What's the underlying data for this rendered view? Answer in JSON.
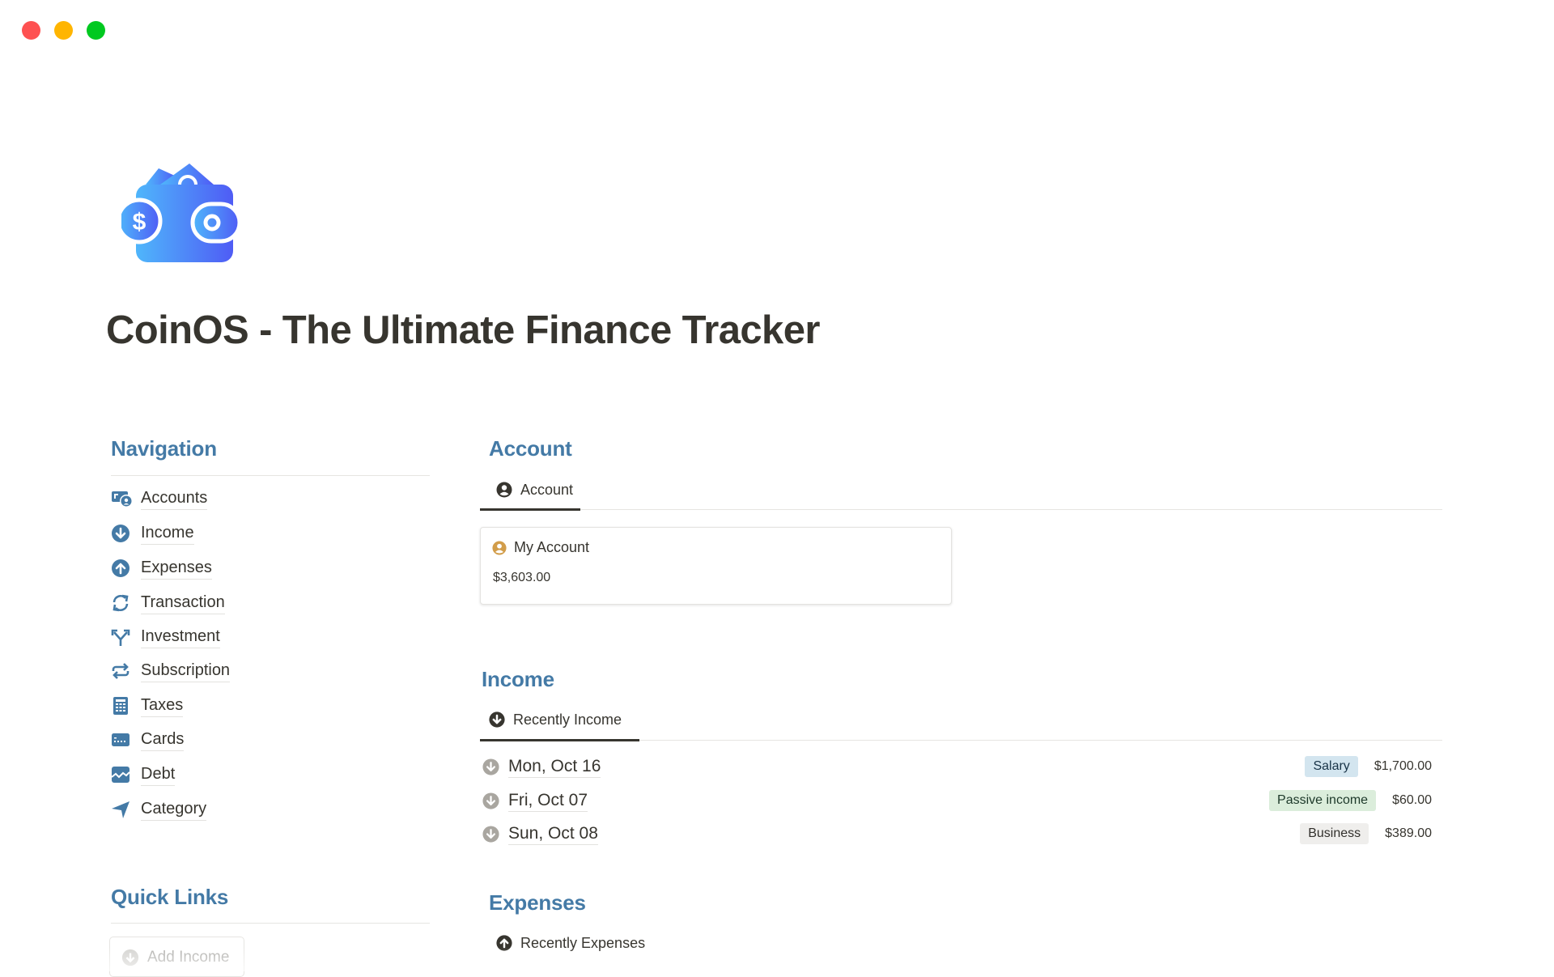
{
  "window": {
    "controls": [
      "close",
      "minimize",
      "maximize"
    ]
  },
  "page": {
    "icon": "wallet-icon",
    "title": "CoinOS - The Ultimate Finance Tracker"
  },
  "navigation": {
    "heading": "Navigation",
    "items": [
      {
        "label": "Accounts",
        "icon": "accounts-icon"
      },
      {
        "label": "Income",
        "icon": "arrow-down-circle-icon"
      },
      {
        "label": "Expenses",
        "icon": "arrow-up-circle-icon"
      },
      {
        "label": "Transaction",
        "icon": "refresh-icon"
      },
      {
        "label": "Investment",
        "icon": "split-arrows-icon"
      },
      {
        "label": "Subscription",
        "icon": "repeat-icon"
      },
      {
        "label": "Taxes",
        "icon": "calculator-icon"
      },
      {
        "label": "Cards",
        "icon": "credit-card-icon"
      },
      {
        "label": "Debt",
        "icon": "chart-line-icon"
      },
      {
        "label": "Category",
        "icon": "navigation-arrow-icon"
      }
    ]
  },
  "quick_links": {
    "heading": "Quick Links",
    "buttons": [
      {
        "label": "Add Income",
        "icon": "arrow-down-circle-icon"
      }
    ]
  },
  "account": {
    "heading": "Account",
    "tab": {
      "label": "Account",
      "icon": "user-circle-icon"
    },
    "cards": [
      {
        "title": "My Account",
        "amount": "$3,603.00",
        "icon": "user-circle-icon"
      }
    ]
  },
  "income": {
    "heading": "Income",
    "tab": {
      "label": "Recently Income",
      "icon": "arrow-down-circle-icon"
    },
    "rows": [
      {
        "date": "Mon, Oct 16",
        "tag": "Salary",
        "tag_bg": "#d3e5ef",
        "tag_fg": "#183347",
        "amount": "$1,700.00"
      },
      {
        "date": "Fri, Oct 07",
        "tag": "Passive income",
        "tag_bg": "#dbeddb",
        "tag_fg": "#1c3829",
        "amount": "$60.00"
      },
      {
        "date": "Sun, Oct 08",
        "tag": "Business",
        "tag_bg": "#efeeec",
        "tag_fg": "#32302c",
        "amount": "$389.00"
      }
    ]
  },
  "expenses": {
    "heading": "Expenses",
    "tab": {
      "label": "Recently Expenses",
      "icon": "arrow-up-circle-icon"
    }
  },
  "colors": {
    "accent": "#447aa6",
    "text": "#37352f",
    "account_icon": "#d29d4a",
    "row_icon": "#a9a6a0"
  }
}
